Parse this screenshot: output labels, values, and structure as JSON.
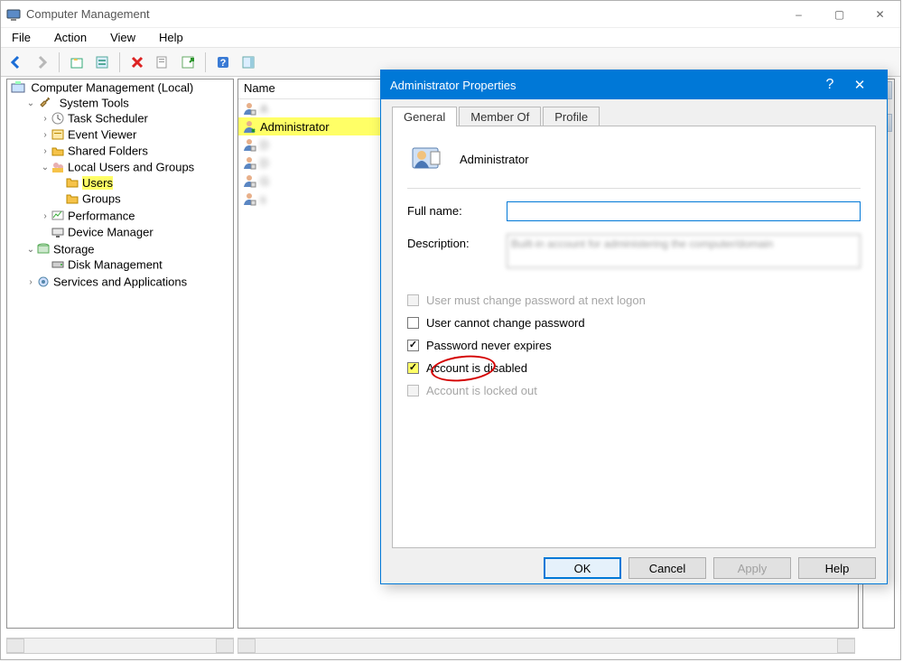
{
  "window": {
    "title": "Computer Management",
    "controls": {
      "minimize": "–",
      "maximize": "▢",
      "close": "✕"
    }
  },
  "menu": {
    "file": "File",
    "action": "Action",
    "view": "View",
    "help": "Help"
  },
  "toolbar_icons": {
    "back": "back-arrow",
    "forward": "forward-arrow",
    "up": "up-level",
    "props": "properties",
    "delete": "delete-x",
    "export": "export-list",
    "refresh": "refresh",
    "help": "help",
    "show_hide": "show-hide-action-pane"
  },
  "tree": {
    "root": "Computer Management (Local)",
    "system_tools": "System Tools",
    "task_scheduler": "Task Scheduler",
    "event_viewer": "Event Viewer",
    "shared_folders": "Shared Folders",
    "local_users_groups": "Local Users and Groups",
    "users": "Users",
    "groups": "Groups",
    "performance": "Performance",
    "device_manager": "Device Manager",
    "storage": "Storage",
    "disk_management": "Disk Management",
    "services_apps": "Services and Applications"
  },
  "list": {
    "header": "Name",
    "items": [
      {
        "label": "A",
        "blur": true
      },
      {
        "label": "Administrator",
        "selected": true
      },
      {
        "label": "D",
        "blur": true
      },
      {
        "label": "D",
        "blur": true
      },
      {
        "label": "G",
        "blur": true
      },
      {
        "label": "s",
        "blur": true
      }
    ]
  },
  "dialog": {
    "title": "Administrator Properties",
    "help_glyph": "?",
    "close_glyph": "✕",
    "tabs": {
      "general": "General",
      "member_of": "Member Of",
      "profile": "Profile"
    },
    "username": "Administrator",
    "fullname_label": "Full name:",
    "fullname_value": "",
    "description_label": "Description:",
    "description_value": "Built-in account for administering the computer/domain",
    "checks": {
      "must_change": "User must change password at next logon",
      "cannot_change": "User cannot change password",
      "never_expires": "Password never expires",
      "disabled": "Account is disabled",
      "locked": "Account is locked out"
    },
    "checks_state": {
      "must_change": {
        "checked": false,
        "enabled": false
      },
      "cannot_change": {
        "checked": false,
        "enabled": true
      },
      "never_expires": {
        "checked": true,
        "enabled": true
      },
      "disabled": {
        "checked": true,
        "enabled": true,
        "highlighted": true
      },
      "locked": {
        "checked": false,
        "enabled": false
      }
    },
    "buttons": {
      "ok": "OK",
      "cancel": "Cancel",
      "apply": "Apply",
      "help": "Help"
    }
  }
}
